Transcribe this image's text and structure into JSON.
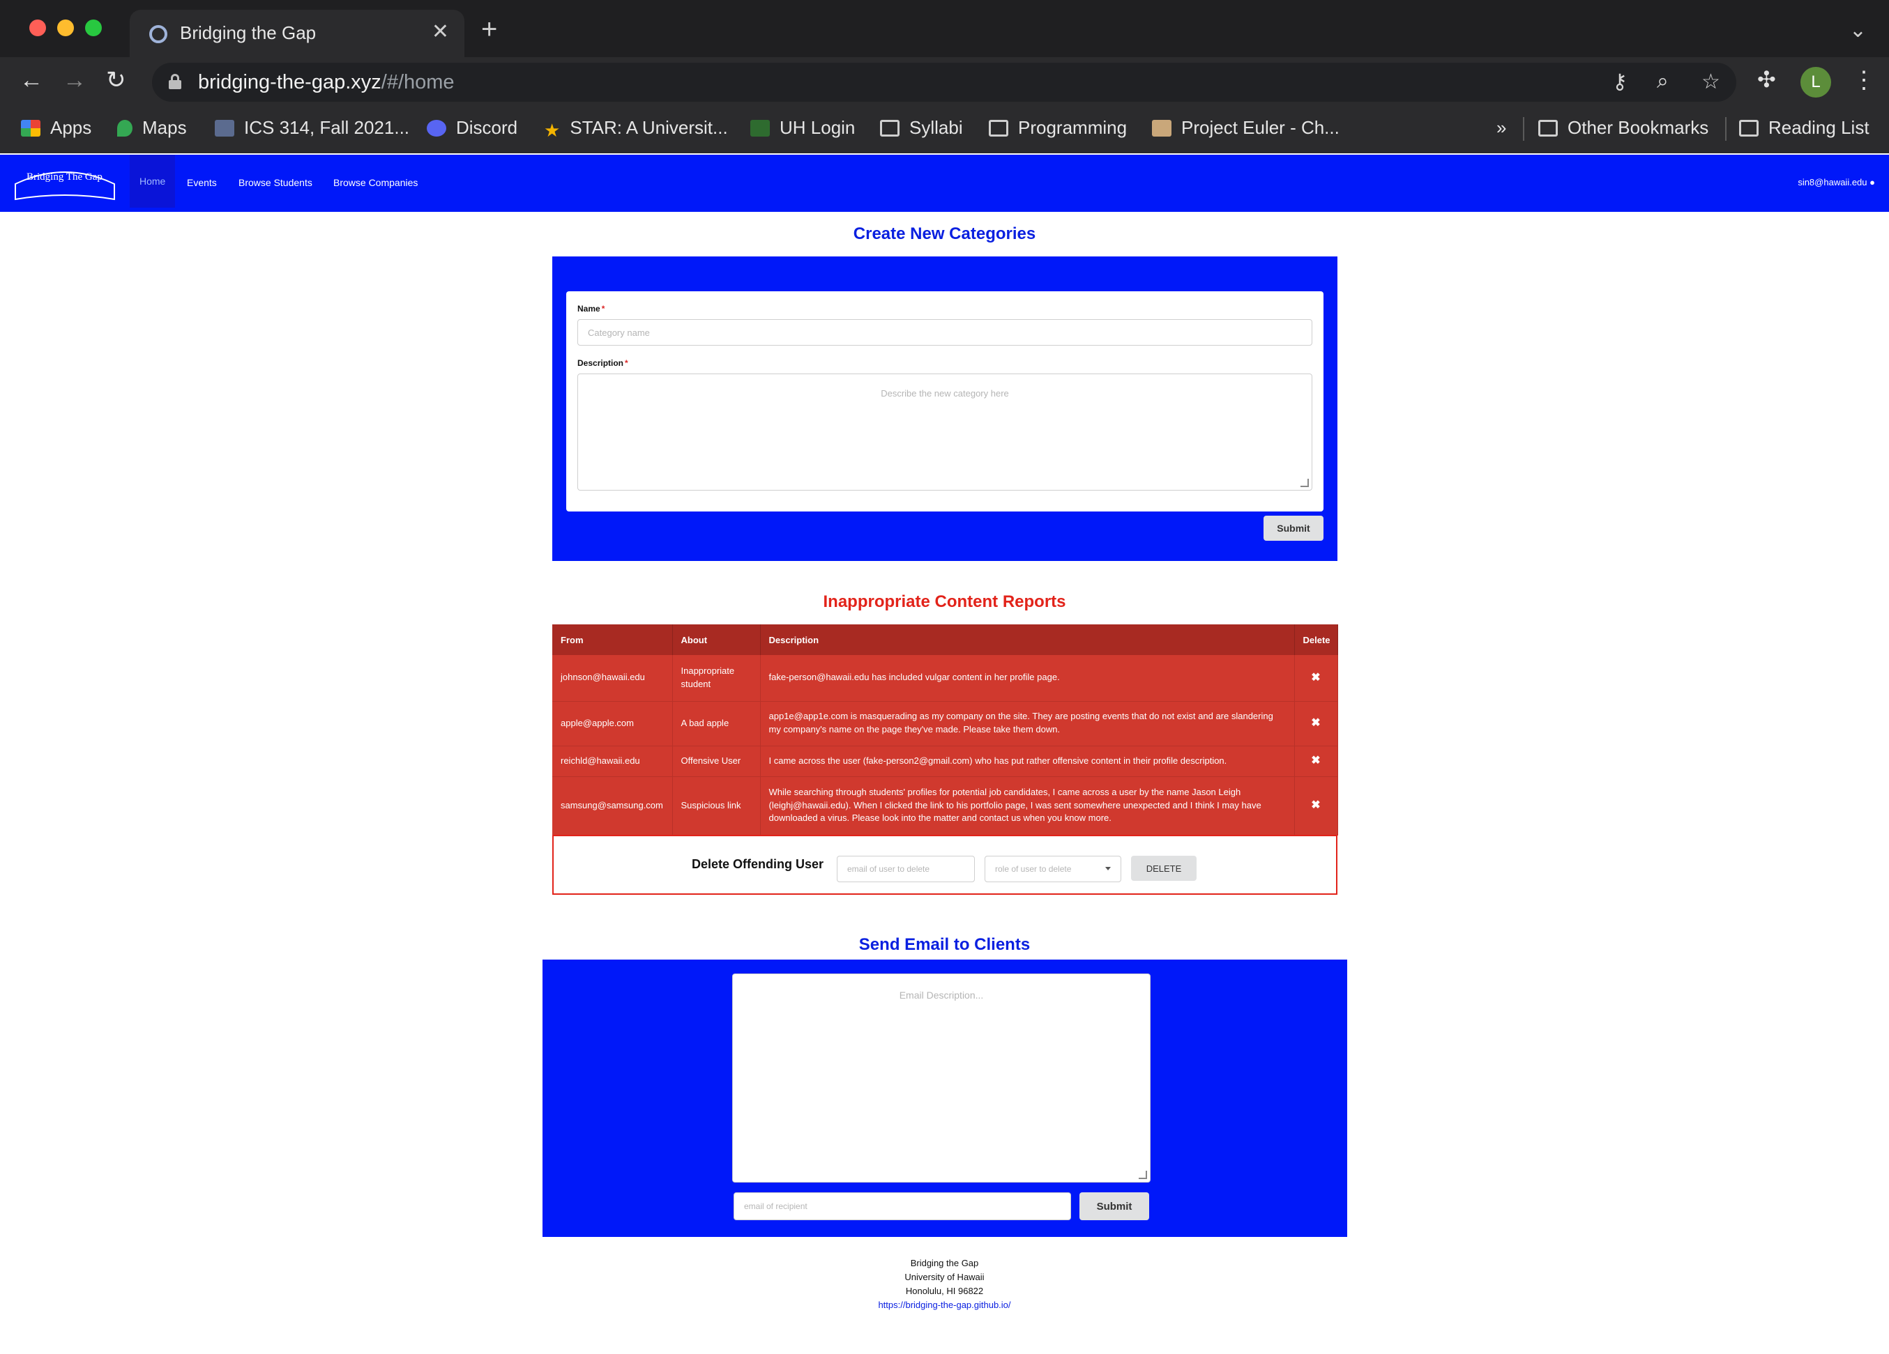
{
  "browser": {
    "tab_title": "Bridging the Gap",
    "tab_close": "✕",
    "new_tab": "+",
    "url_host": "bridging-the-gap.xyz",
    "url_path": "/#/home",
    "profile_initial": "L",
    "bookmarks": [
      {
        "label": "Apps",
        "icon": "apps-grid-icon"
      },
      {
        "label": "Maps",
        "icon": "maps-pin-icon"
      },
      {
        "label": "ICS 314, Fall 2021...",
        "icon": "page-icon"
      },
      {
        "label": "Discord",
        "icon": "discord-icon"
      },
      {
        "label": "STAR: A Universit...",
        "icon": "star-icon"
      },
      {
        "label": "UH Login",
        "icon": "uh-icon"
      },
      {
        "label": "Syllabi",
        "icon": "folder-icon"
      },
      {
        "label": "Programming",
        "icon": "folder-icon"
      },
      {
        "label": "Project Euler - Ch...",
        "icon": "pe-icon"
      }
    ],
    "more_bookmarks": "»",
    "other_bookmarks": "Other Bookmarks",
    "reading_list": "Reading List"
  },
  "navbar": {
    "logo_text": "Bridging The Gap",
    "links": [
      "Home",
      "Events",
      "Browse Students",
      "Browse Companies"
    ],
    "user_email": "sin8@hawaii.edu"
  },
  "create_categories": {
    "title": "Create New Categories",
    "name_label": "Name",
    "name_placeholder": "Category name",
    "description_label": "Description",
    "description_placeholder": "Describe the new category here",
    "required_mark": "*",
    "submit": "Submit"
  },
  "reports": {
    "title": "Inappropriate Content Reports",
    "columns": [
      "From",
      "About",
      "Description",
      "Delete"
    ],
    "rows": [
      {
        "from": "johnson@hawaii.edu",
        "about": "Inappropriate student",
        "description": "fake-person@hawaii.edu has included vulgar content in her profile page.",
        "delete": "✖"
      },
      {
        "from": "apple@apple.com",
        "about": "A bad apple",
        "description": "app1e@app1e.com is masquerading as my company on the site. They are posting events that do not exist and are slandering my company's name on the page they've made. Please take them down.",
        "delete": "✖"
      },
      {
        "from": "reichld@hawaii.edu",
        "about": "Offensive User",
        "description": "I came across the user (fake-person2@gmail.com) who has put rather offensive content in their profile description.",
        "delete": "✖"
      },
      {
        "from": "samsung@samsung.com",
        "about": "Suspicious link",
        "description": "While searching through students' profiles for potential job candidates, I came across a user by the name Jason Leigh (leighj@hawaii.edu). When I clicked the link to his portfolio page, I was sent somewhere unexpected and I think I may have downloaded a virus. Please look into the matter and contact us when you know more.",
        "delete": "✖"
      }
    ]
  },
  "delete_user": {
    "label": "Delete Offending User",
    "email_placeholder": "email of user to delete",
    "role_placeholder": "role of user to delete",
    "button": "DELETE"
  },
  "email": {
    "title": "Send Email to Clients",
    "description_placeholder": "Email Description...",
    "recipient_placeholder": "email of recipient",
    "submit": "Submit"
  },
  "footer": {
    "line1": "Bridging the Gap",
    "line2": "University of Hawaii",
    "line3": "Honolulu, HI 96822",
    "link": "https://bridging-the-gap.github.io/"
  },
  "colors": {
    "brand_blue": "#0018f9",
    "report_red": "#d0392e",
    "title_red": "#e2231a"
  }
}
